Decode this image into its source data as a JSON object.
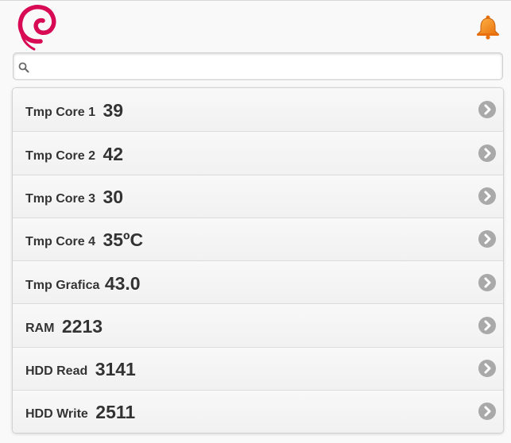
{
  "header": {
    "logo_icon": "debian-swirl-icon",
    "notification_icon": "bell-icon",
    "colors": {
      "logo": "#d70a53",
      "bell": "#f7931e"
    }
  },
  "search": {
    "value": "",
    "placeholder": "",
    "icon": "search-icon"
  },
  "list": {
    "items": [
      {
        "label": "Tmp Core 1",
        "value": "39"
      },
      {
        "label": "Tmp Core 2",
        "value": "42"
      },
      {
        "label": "Tmp Core 3",
        "value": "30"
      },
      {
        "label": "Tmp Core 4",
        "value": "35ºC"
      },
      {
        "label": "Tmp Grafica",
        "value": "43.0"
      },
      {
        "label": "RAM",
        "value": "2213"
      },
      {
        "label": "HDD Read",
        "value": "3141"
      },
      {
        "label": "HDD Write",
        "value": "2511"
      }
    ],
    "arrow_icon": "chevron-right-icon"
  }
}
